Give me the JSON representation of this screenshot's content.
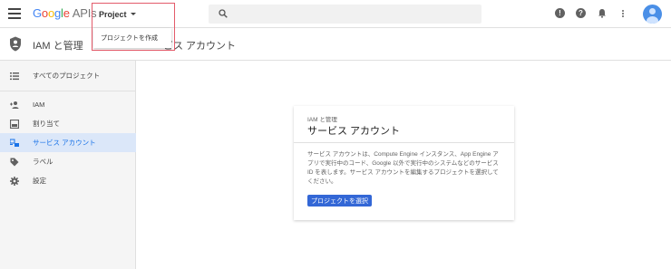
{
  "header": {
    "logo": {
      "g1": "G",
      "g2": "o",
      "g3": "o",
      "g4": "g",
      "g5": "l",
      "g6": "e",
      "apis": "APIs"
    },
    "project_label": "Project",
    "search": {
      "icon": "search-icon"
    },
    "icons": [
      "alert-icon",
      "help-icon",
      "notifications-icon",
      "more-vert-icon"
    ],
    "avatar_icon": "account-avatar"
  },
  "dropdown": {
    "item_label": "プロジェクトを作成"
  },
  "sidebar": {
    "section_title": "IAM と管理",
    "items": [
      {
        "label": "すべてのプロジェクト",
        "icon": "list-icon"
      },
      {
        "label": "IAM",
        "icon": "person-add-icon"
      },
      {
        "label": "割り当て",
        "icon": "quota-icon"
      },
      {
        "label": "サービス アカウント",
        "icon": "service-account-icon"
      },
      {
        "label": "ラベル",
        "icon": "label-icon"
      },
      {
        "label": "設定",
        "icon": "gear-icon"
      }
    ]
  },
  "main": {
    "page_title": "ビス アカウント",
    "card": {
      "subtitle": "IAM と管理",
      "title": "サービス アカウント",
      "description": "サービス アカウントは、Compute Engine インスタンス、App Engine アプリで実行中のコード、Google 以外で実行中のシステムなどのサービス ID を表します。サービス アカウントを編集するプロジェクトを選択してください。",
      "button_label": "プロジェクトを選択"
    }
  },
  "colors": {
    "accent": "#3367d6",
    "active_bg": "#dbe7f9",
    "highlight": "#e35b6a"
  }
}
